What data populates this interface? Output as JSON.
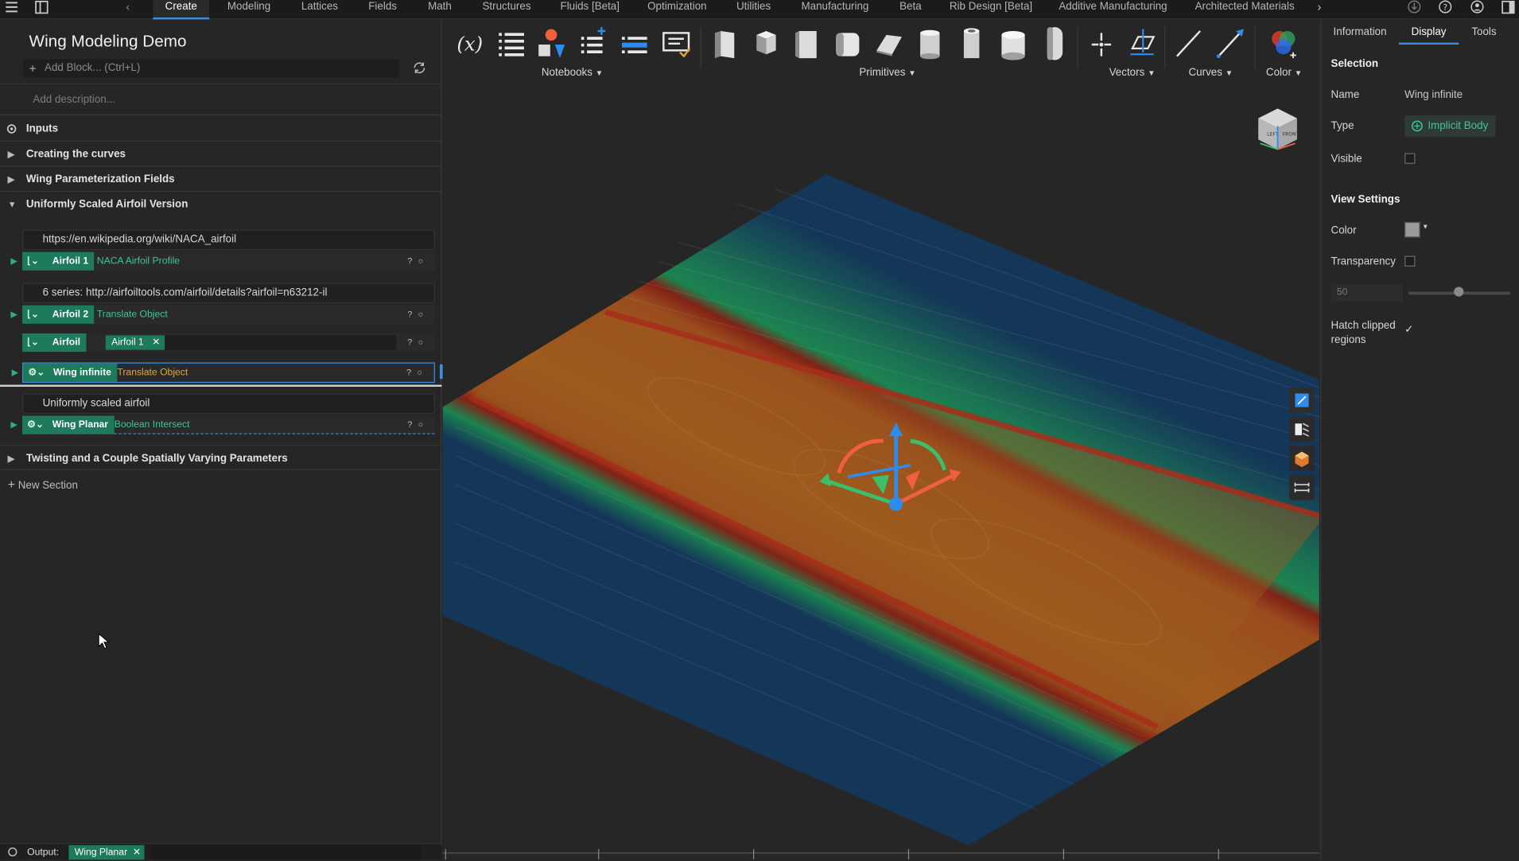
{
  "nav": {
    "tabs": [
      "Create",
      "Modeling",
      "Lattices",
      "Fields",
      "Math",
      "Structures",
      "Fluids [Beta]",
      "Optimization",
      "Utilities",
      "Manufacturing",
      "Beta",
      "Rib Design [Beta]",
      "Additive Manufacturing",
      "Architected Materials"
    ],
    "active_tab": "Create"
  },
  "notebook": {
    "title": "Wing Modeling Demo",
    "add_block_placeholder": "Add Block... (Ctrl+L)",
    "description_placeholder": "Add description...",
    "sections": [
      {
        "label": "Inputs",
        "state": "icon"
      },
      {
        "label": "Creating the curves",
        "state": "collapsed"
      },
      {
        "label": "Wing Parameterization Fields",
        "state": "collapsed"
      },
      {
        "label": "Uniformly Scaled Airfoil Version",
        "state": "expanded"
      },
      {
        "label": "Twisting and a Couple Spatially Varying Parameters",
        "state": "collapsed"
      }
    ],
    "cells": {
      "text1": "https://en.wikipedia.org/wiki/NACA_airfoil",
      "text2": "6 series: http://airfoiltools.com/airfoil/details?airfoil=n63212-il",
      "text3": "Uniformly scaled airfoil"
    },
    "blocks": {
      "airfoil1": {
        "name": "Airfoil 1",
        "op": "NACA Airfoil Profile"
      },
      "airfoil2": {
        "name": "Airfoil 2",
        "op": "Translate Object"
      },
      "airfoil": {
        "name": "Airfoil",
        "chip": "Airfoil 1"
      },
      "wing_infinite": {
        "name": "Wing infinite",
        "op": "Translate Object"
      },
      "wing_planar": {
        "name": "Wing Planar",
        "op": "Boolean Intersect"
      }
    },
    "new_section": "New Section",
    "output_label": "Output:",
    "output_chip": "Wing Planar"
  },
  "ribbon": {
    "groups": [
      "Notebooks",
      "Primitives",
      "Vectors",
      "Curves",
      "Color"
    ]
  },
  "panel": {
    "tabs": [
      "Information",
      "Display",
      "Tools"
    ],
    "active_tab": "Display",
    "selection_header": "Selection",
    "name_label": "Name",
    "name_value": "Wing infinite",
    "type_label": "Type",
    "type_value": "Implicit Body",
    "visible_label": "Visible",
    "view_settings_header": "View Settings",
    "color_label": "Color",
    "transparency_label": "Transparency",
    "transparency_value": "50",
    "hatch_label_1": "Hatch clipped",
    "hatch_label_2": "regions",
    "hatch_checked": true
  },
  "viewcube": {
    "face_left": "LEFT",
    "face_front": "FRONT"
  },
  "colors": {
    "accent": "#3c8fe0",
    "block_green": "#1e7a5c",
    "op_green": "#3cc798",
    "op_orange": "#e0a437"
  }
}
